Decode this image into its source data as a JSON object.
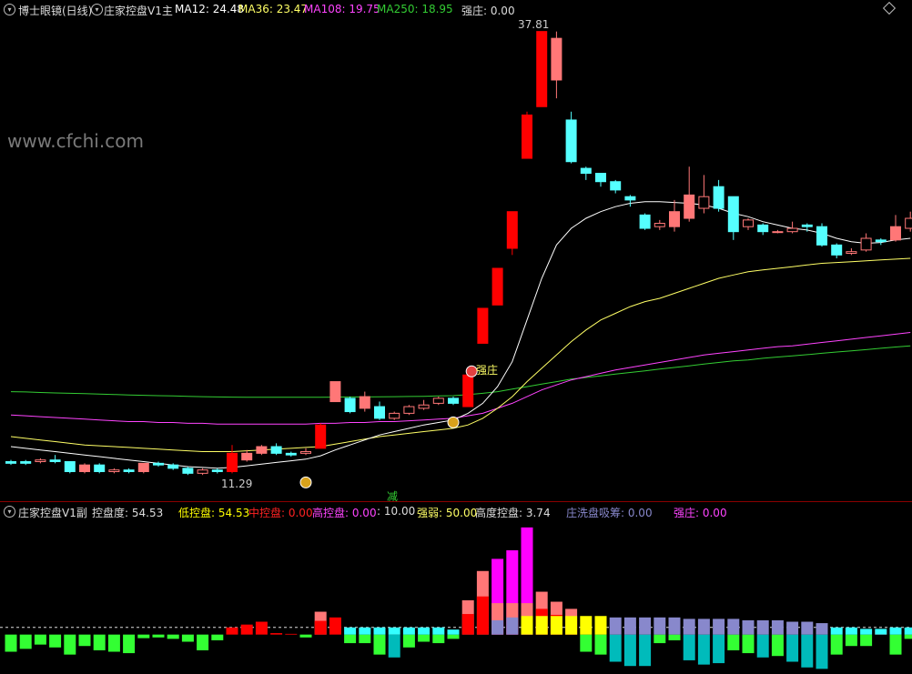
{
  "colors": {
    "up": "#ff7777",
    "down": "#55ffff",
    "strong": "#ff0000",
    "ma12": "#ffffff",
    "ma36": "#ffff66",
    "ma108": "#ff44ff",
    "ma250": "#33cc33",
    "mid": "#ff0000",
    "low": "#ffff00",
    "high": "#ff00ff",
    "wash": "#8888cc",
    "bg": "#000000"
  },
  "main_header": {
    "name": "博士眼镜(日线)",
    "indicator": "庄家控盘V1主",
    "ma12": "MA12: 24.48",
    "ma36": "MA36: 23.47",
    "ma108": "MA108: 19.75",
    "ma250": "MA250: 18.95",
    "strong": "强庄: 0.00"
  },
  "watermark": "www.cfchi.com",
  "annotations": {
    "high": "37.81",
    "low": "11.29",
    "strong_tag": "强庄",
    "reduce": "减"
  },
  "sub_header": {
    "indicator": "庄家控盘V1副",
    "control": "控盘度: 54.53",
    "low": "低控盘: 54.53",
    "mid": "中控盘: 0.00",
    "high": "高控盘: 0.00",
    "ten": ": 10.00",
    "qr": "强弱: 50.00",
    "hd": "高度控盘: 3.74",
    "wash": "庄洗盘吸筹: 0.00",
    "strong": "强庄: 0.00"
  },
  "chart_data": [
    {
      "type": "candlestick",
      "title": "博士眼镜(日线)",
      "ylim": [
        10.5,
        38.5
      ],
      "x": [
        1,
        2,
        3,
        4,
        5,
        6,
        7,
        8,
        9,
        10,
        11,
        12,
        13,
        14,
        15,
        16,
        17,
        18,
        19,
        20,
        21,
        22,
        23,
        24,
        25,
        26,
        27,
        28,
        29,
        30,
        31,
        32,
        33,
        34,
        35,
        36,
        37,
        38,
        39,
        40,
        41,
        42,
        43,
        44,
        45,
        46,
        47,
        48,
        49,
        50,
        51,
        52,
        53,
        54,
        55,
        56,
        57,
        58,
        59,
        60,
        61,
        62
      ],
      "candles": [
        [
          12.0,
          11.9,
          12.1,
          11.8
        ],
        [
          12.0,
          11.9,
          12.1,
          11.8
        ],
        [
          12.0,
          12.1,
          12.2,
          11.9
        ],
        [
          12.1,
          12.0,
          12.4,
          11.9
        ],
        [
          12.0,
          11.4,
          12.0,
          11.3
        ],
        [
          11.4,
          11.8,
          11.9,
          11.3
        ],
        [
          11.8,
          11.4,
          11.9,
          11.3
        ],
        [
          11.4,
          11.5,
          11.6,
          11.3
        ],
        [
          11.5,
          11.4,
          11.6,
          11.3
        ],
        [
          11.4,
          11.9,
          11.9,
          11.3
        ],
        [
          11.9,
          11.8,
          12.0,
          11.7
        ],
        [
          11.8,
          11.6,
          11.9,
          11.5
        ],
        [
          11.6,
          11.3,
          11.7,
          11.2
        ],
        [
          11.3,
          11.5,
          11.6,
          11.2
        ],
        [
          11.5,
          11.4,
          11.6,
          11.29
        ],
        [
          11.4,
          12.5,
          13.0,
          11.3
        ],
        [
          12.1,
          12.5,
          12.7,
          12.0
        ],
        [
          12.5,
          12.9,
          13.0,
          12.4
        ],
        [
          12.9,
          12.5,
          13.1,
          12.4
        ],
        [
          12.5,
          12.4,
          12.6,
          12.3
        ],
        [
          12.5,
          12.6,
          12.8,
          12.4
        ],
        [
          12.8,
          14.2,
          14.3,
          12.8
        ],
        [
          15.6,
          16.8,
          16.8,
          15.6
        ],
        [
          15.8,
          15.0,
          15.9,
          14.9
        ],
        [
          15.2,
          15.9,
          16.2,
          15.0
        ],
        [
          15.3,
          14.6,
          15.6,
          14.5
        ],
        [
          14.6,
          14.9,
          15.0,
          14.5
        ],
        [
          14.9,
          15.3,
          15.4,
          14.8
        ],
        [
          15.2,
          15.4,
          15.7,
          15.1
        ],
        [
          15.5,
          15.8,
          15.9,
          15.4
        ],
        [
          15.8,
          15.5,
          15.9,
          15.4
        ],
        [
          15.3,
          17.2,
          17.2,
          15.3
        ],
        [
          19.1,
          21.2,
          21.2,
          19.1
        ],
        [
          21.4,
          23.6,
          23.6,
          21.4
        ],
        [
          24.8,
          27.0,
          27.0,
          24.4
        ],
        [
          30.2,
          32.8,
          33.0,
          30.2
        ],
        [
          33.3,
          37.81,
          37.81,
          33.3
        ],
        [
          34.9,
          37.4,
          37.81,
          33.8
        ],
        [
          32.5,
          30.0,
          33.0,
          29.9
        ],
        [
          29.6,
          29.3,
          29.7,
          28.9
        ],
        [
          29.3,
          28.8,
          29.3,
          28.5
        ],
        [
          28.8,
          28.3,
          28.9,
          28.1
        ],
        [
          27.9,
          27.7,
          28.0,
          27.3
        ],
        [
          26.8,
          26.0,
          26.9,
          25.9
        ],
        [
          26.1,
          26.3,
          26.5,
          25.9
        ],
        [
          26.1,
          27.0,
          27.7,
          25.8
        ],
        [
          26.6,
          28.0,
          29.7,
          26.4
        ],
        [
          27.2,
          27.9,
          29.2,
          26.9
        ],
        [
          28.5,
          27.2,
          28.9,
          27.0
        ],
        [
          27.9,
          25.8,
          27.9,
          25.3
        ],
        [
          26.1,
          26.5,
          26.6,
          25.9
        ],
        [
          26.2,
          25.8,
          26.3,
          25.6
        ],
        [
          25.8,
          25.8,
          25.9,
          25.7
        ],
        [
          25.8,
          26.0,
          26.4,
          25.7
        ],
        [
          26.2,
          26.1,
          26.3,
          25.8
        ],
        [
          26.1,
          25.0,
          26.3,
          24.9
        ],
        [
          25.0,
          24.4,
          25.1,
          24.2
        ],
        [
          24.5,
          24.6,
          24.8,
          24.4
        ],
        [
          24.7,
          25.4,
          25.7,
          24.6
        ],
        [
          25.3,
          25.2,
          25.4,
          25.0
        ],
        [
          25.3,
          26.1,
          26.8,
          25.2
        ],
        [
          26.0,
          26.6,
          27.0,
          25.8
        ]
      ],
      "series": [
        {
          "name": "MA12",
          "values": [
            12.9,
            12.8,
            12.7,
            12.6,
            12.5,
            12.4,
            12.3,
            12.2,
            12.1,
            12.0,
            11.9,
            11.8,
            11.7,
            11.65,
            11.6,
            11.65,
            11.75,
            11.85,
            11.95,
            12.05,
            12.15,
            12.35,
            12.7,
            13.0,
            13.3,
            13.6,
            13.8,
            14.0,
            14.2,
            14.35,
            14.5,
            14.9,
            15.5,
            16.5,
            18.0,
            20.5,
            23.0,
            25.0,
            26.0,
            26.6,
            27.0,
            27.3,
            27.5,
            27.6,
            27.6,
            27.55,
            27.5,
            27.4,
            27.2,
            26.9,
            26.7,
            26.4,
            26.2,
            26.0,
            25.9,
            25.7,
            25.4,
            25.2,
            25.1,
            25.15,
            25.3,
            25.4
          ]
        },
        {
          "name": "MA36",
          "values": [
            13.5,
            13.4,
            13.3,
            13.2,
            13.1,
            13.0,
            12.95,
            12.9,
            12.85,
            12.8,
            12.75,
            12.7,
            12.65,
            12.6,
            12.6,
            12.6,
            12.65,
            12.7,
            12.75,
            12.8,
            12.85,
            12.9,
            13.05,
            13.2,
            13.35,
            13.5,
            13.6,
            13.7,
            13.8,
            13.9,
            14.0,
            14.2,
            14.6,
            15.2,
            15.9,
            16.8,
            17.6,
            18.4,
            19.2,
            19.9,
            20.5,
            20.9,
            21.3,
            21.6,
            21.8,
            22.1,
            22.4,
            22.7,
            23.0,
            23.2,
            23.4,
            23.5,
            23.6,
            23.7,
            23.8,
            23.9,
            23.95,
            24.0,
            24.05,
            24.1,
            24.15,
            24.2
          ]
        },
        {
          "name": "MA108",
          "values": [
            14.8,
            14.75,
            14.7,
            14.65,
            14.6,
            14.55,
            14.5,
            14.45,
            14.4,
            14.4,
            14.35,
            14.35,
            14.3,
            14.3,
            14.25,
            14.25,
            14.25,
            14.25,
            14.25,
            14.25,
            14.25,
            14.3,
            14.3,
            14.35,
            14.35,
            14.4,
            14.4,
            14.45,
            14.5,
            14.55,
            14.6,
            14.75,
            14.9,
            15.2,
            15.5,
            15.9,
            16.3,
            16.6,
            16.9,
            17.1,
            17.3,
            17.5,
            17.65,
            17.8,
            17.95,
            18.1,
            18.25,
            18.4,
            18.5,
            18.6,
            18.7,
            18.8,
            18.9,
            18.95,
            19.05,
            19.15,
            19.25,
            19.35,
            19.45,
            19.55,
            19.65,
            19.75
          ]
        },
        {
          "name": "MA250",
          "values": [
            16.2,
            16.18,
            16.15,
            16.12,
            16.1,
            16.08,
            16.05,
            16.03,
            16.0,
            15.98,
            15.96,
            15.94,
            15.92,
            15.9,
            15.88,
            15.87,
            15.86,
            15.86,
            15.86,
            15.86,
            15.86,
            15.86,
            15.87,
            15.88,
            15.88,
            15.89,
            15.9,
            15.91,
            15.92,
            15.94,
            15.96,
            16.02,
            16.1,
            16.2,
            16.35,
            16.5,
            16.65,
            16.8,
            16.95,
            17.05,
            17.15,
            17.25,
            17.35,
            17.45,
            17.55,
            17.65,
            17.75,
            17.85,
            17.95,
            18.05,
            18.1,
            18.2,
            18.28,
            18.35,
            18.42,
            18.5,
            18.58,
            18.65,
            18.72,
            18.8,
            18.88,
            18.95
          ]
        }
      ]
    },
    {
      "type": "bar",
      "title": "庄家控盘V1副",
      "ylim": [
        -4.5,
        16
      ],
      "x": [
        1,
        2,
        3,
        4,
        5,
        6,
        7,
        8,
        9,
        10,
        11,
        12,
        13,
        14,
        15,
        16,
        17,
        18,
        19,
        20,
        21,
        22,
        23,
        24,
        25,
        26,
        27,
        28,
        29,
        30,
        31,
        32,
        33,
        34,
        35,
        36,
        37,
        38,
        39,
        40,
        41,
        42,
        43,
        44,
        45,
        46,
        47,
        48,
        49,
        50,
        51,
        52,
        53,
        54,
        55,
        56,
        57,
        58,
        59,
        60,
        61,
        62
      ],
      "series": [
        {
          "name": "控盘度",
          "values": [
            -2.4,
            -2.0,
            -1.4,
            -1.8,
            -2.8,
            -1.6,
            -2.2,
            -2.4,
            -2.6,
            -0.5,
            -0.4,
            -0.6,
            -1.0,
            -2.2,
            -0.8,
            1.0,
            1.4,
            1.8,
            0.2,
            0.1,
            -0.4,
            3.2,
            2.4,
            -1.2,
            -1.2,
            -2.8,
            -3.2,
            -1.8,
            -1.0,
            -1.2,
            -0.6,
            4.8,
            8.9,
            10.6,
            11.8,
            15.0,
            6.0,
            4.6,
            3.6,
            -2.4,
            -2.8,
            -3.8,
            -4.4,
            -4.4,
            -1.2,
            -0.8,
            -3.6,
            -4.2,
            -4.0,
            -2.2,
            -2.6,
            -3.2,
            -3.0,
            -3.8,
            -4.6,
            -4.8,
            -2.8,
            -1.6,
            -1.6,
            0.6,
            -2.8,
            -0.6
          ]
        },
        {
          "name": "强弱",
          "values": [
            0,
            0,
            0,
            0,
            0,
            0,
            0,
            0,
            0,
            0,
            0,
            0,
            0,
            0,
            0,
            0,
            0,
            0,
            0,
            0,
            0,
            0,
            0,
            1.0,
            1.0,
            1.0,
            1.0,
            1.0,
            1.0,
            1.0,
            0.7,
            0,
            0,
            2.0,
            2.4,
            2.6,
            2.6,
            2.6,
            2.6,
            2.6,
            2.6,
            2.4,
            2.4,
            2.4,
            2.4,
            2.4,
            2.2,
            2.2,
            2.2,
            2.2,
            2.0,
            2.0,
            2.0,
            1.8,
            1.8,
            1.6,
            1.0,
            1.0,
            0.8,
            0.8,
            1.0,
            1.0
          ]
        }
      ]
    }
  ]
}
